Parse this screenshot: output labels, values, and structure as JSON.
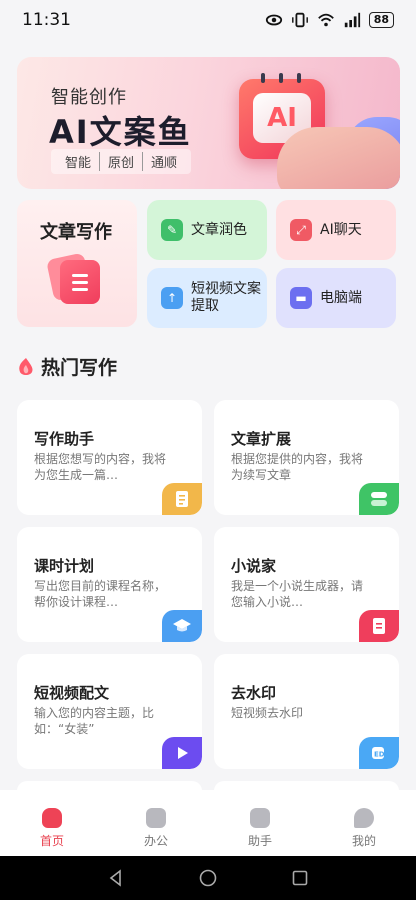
{
  "status": {
    "time": "11:31",
    "battery": "88"
  },
  "banner": {
    "subtitle": "智能创作",
    "title": "AI文案鱼",
    "tags": [
      "智能",
      "原创",
      "通顺"
    ],
    "chip_text": "AI"
  },
  "features": {
    "big": {
      "label": "文章写作"
    },
    "items": [
      {
        "label": "文章润色",
        "icon": "pencil-icon"
      },
      {
        "label": "AI聊天",
        "icon": "arrows-icon"
      },
      {
        "label": "短视频文案提取",
        "icon": "upload-icon"
      },
      {
        "label": "电脑端",
        "icon": "monitor-icon"
      }
    ]
  },
  "section": {
    "title": "热门写作"
  },
  "tools": [
    {
      "title": "写作助手",
      "desc": "根据您想写的内容，我将为您生成一篇…",
      "icon": "doc-icon",
      "color": "#f2b74a"
    },
    {
      "title": "文章扩展",
      "desc": "根据您提供的内容，我将为续写文章",
      "icon": "stack-icon",
      "color": "#3fc466"
    },
    {
      "title": "课时计划",
      "desc": "写出您目前的课程名称，帮你设计课程…",
      "icon": "graduation-cap-icon",
      "color": "#4b9ff2"
    },
    {
      "title": "小说家",
      "desc": "我是一个小说生成器，请您输入小说…",
      "icon": "book-icon",
      "color": "#ef3e5c"
    },
    {
      "title": "短视频配文",
      "desc": "输入您的内容主题，比如：“女装”",
      "icon": "play-icon",
      "color": "#6c4cf0"
    },
    {
      "title": "去水印",
      "desc": "短视频去水印",
      "icon": "stamp-icon",
      "color": "#4aa8f5"
    }
  ],
  "tabs": [
    {
      "label": "首页",
      "active": true
    },
    {
      "label": "办公",
      "active": false
    },
    {
      "label": "助手",
      "active": false
    },
    {
      "label": "我的",
      "active": false
    }
  ]
}
